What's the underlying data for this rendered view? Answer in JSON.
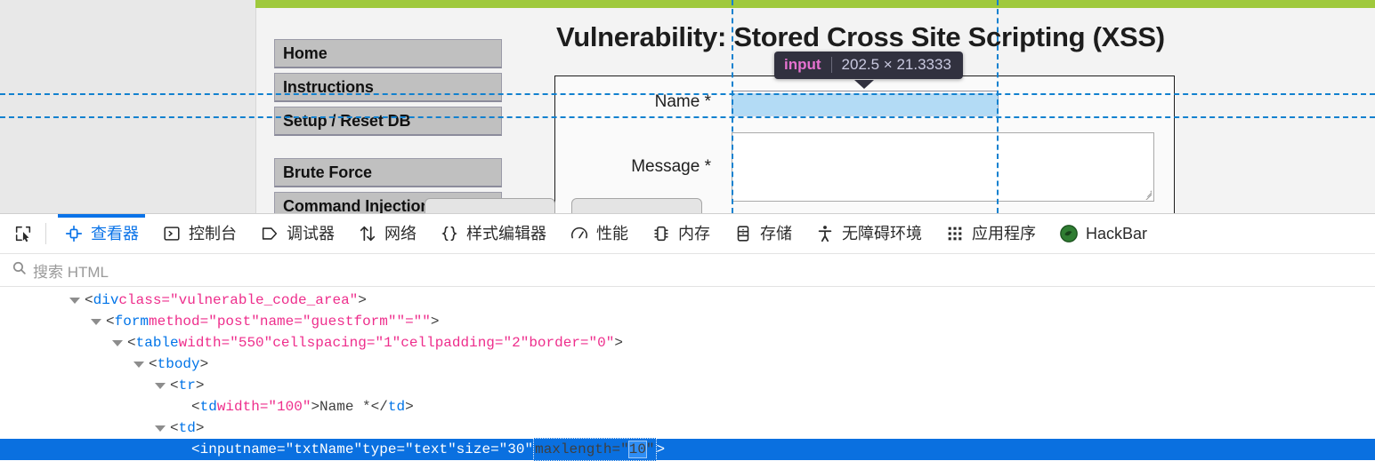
{
  "page": {
    "title": "Vulnerability: Stored Cross Site Scripting (XSS)",
    "accent_green": "#9fc93c",
    "menu": [
      {
        "label": "Home"
      },
      {
        "label": "Instructions"
      },
      {
        "label": "Setup / Reset DB"
      },
      {
        "label": "Brute Force"
      },
      {
        "label": "Command Injection"
      }
    ],
    "form": {
      "name_label": "Name *",
      "name_value": "",
      "message_label": "Message *",
      "message_value": ""
    }
  },
  "highlight_tooltip": {
    "tag": "input",
    "dimensions": "202.5 × 21.3333"
  },
  "devtools": {
    "picker_icon": "element-picker-icon",
    "tabs": [
      {
        "label": "查看器",
        "icon": "inspector-icon",
        "active": true
      },
      {
        "label": "控制台",
        "icon": "console-icon",
        "active": false
      },
      {
        "label": "调试器",
        "icon": "debugger-icon",
        "active": false
      },
      {
        "label": "网络",
        "icon": "network-icon",
        "active": false
      },
      {
        "label": "样式编辑器",
        "icon": "style-editor-icon",
        "active": false
      },
      {
        "label": "性能",
        "icon": "performance-icon",
        "active": false
      },
      {
        "label": "内存",
        "icon": "memory-icon",
        "active": false
      },
      {
        "label": "存储",
        "icon": "storage-icon",
        "active": false
      },
      {
        "label": "无障碍环境",
        "icon": "accessibility-icon",
        "active": false
      },
      {
        "label": "应用程序",
        "icon": "application-icon",
        "active": false
      },
      {
        "label": "HackBar",
        "icon": "hackbar-icon",
        "active": false
      }
    ],
    "search": {
      "placeholder": "搜索 HTML",
      "value": "",
      "icon": "search-icon"
    },
    "markup": {
      "lines": [
        {
          "id": "l1",
          "indent": 78,
          "twisty": true,
          "selected": false,
          "parts": [
            {
              "t": "punct",
              "v": "<"
            },
            {
              "t": "tag",
              "v": "div"
            },
            {
              "t": "punct",
              "v": " "
            },
            {
              "t": "attr",
              "v": "class=\"vulnerable_code_area\""
            },
            {
              "t": "punct",
              "v": ">"
            }
          ]
        },
        {
          "id": "l2",
          "indent": 102,
          "twisty": true,
          "selected": false,
          "parts": [
            {
              "t": "punct",
              "v": "<"
            },
            {
              "t": "tag",
              "v": "form"
            },
            {
              "t": "punct",
              "v": " "
            },
            {
              "t": "attr",
              "v": "method=\"post\""
            },
            {
              "t": "punct",
              "v": " "
            },
            {
              "t": "attr",
              "v": "name=\"guestform\""
            },
            {
              "t": "punct",
              "v": " "
            },
            {
              "t": "attr",
              "v": "\"=\"\""
            },
            {
              "t": "punct",
              "v": ">"
            }
          ]
        },
        {
          "id": "l3",
          "indent": 126,
          "twisty": true,
          "selected": false,
          "parts": [
            {
              "t": "punct",
              "v": "<"
            },
            {
              "t": "tag",
              "v": "table"
            },
            {
              "t": "punct",
              "v": " "
            },
            {
              "t": "attr",
              "v": "width=\"550\""
            },
            {
              "t": "punct",
              "v": " "
            },
            {
              "t": "attr",
              "v": "cellspacing=\"1\""
            },
            {
              "t": "punct",
              "v": " "
            },
            {
              "t": "attr",
              "v": "cellpadding=\"2\""
            },
            {
              "t": "punct",
              "v": " "
            },
            {
              "t": "attr",
              "v": "border=\"0\""
            },
            {
              "t": "punct",
              "v": ">"
            }
          ]
        },
        {
          "id": "l4",
          "indent": 150,
          "twisty": true,
          "selected": false,
          "parts": [
            {
              "t": "punct",
              "v": "<"
            },
            {
              "t": "tag",
              "v": "tbody"
            },
            {
              "t": "punct",
              "v": ">"
            }
          ]
        },
        {
          "id": "l5",
          "indent": 174,
          "twisty": true,
          "selected": false,
          "parts": [
            {
              "t": "punct",
              "v": "<"
            },
            {
              "t": "tag",
              "v": "tr"
            },
            {
              "t": "punct",
              "v": ">"
            }
          ]
        },
        {
          "id": "l6",
          "indent": 198,
          "twisty": false,
          "selected": false,
          "parts": [
            {
              "t": "punct",
              "v": "<"
            },
            {
              "t": "tag",
              "v": "td"
            },
            {
              "t": "punct",
              "v": " "
            },
            {
              "t": "attr",
              "v": "width=\"100\""
            },
            {
              "t": "punct",
              "v": ">"
            },
            {
              "t": "txt",
              "v": "Name *"
            },
            {
              "t": "punct",
              "v": "</"
            },
            {
              "t": "tag",
              "v": "td"
            },
            {
              "t": "punct",
              "v": ">"
            }
          ]
        },
        {
          "id": "l7",
          "indent": 174,
          "twisty": true,
          "selected": false,
          "parts": [
            {
              "t": "punct",
              "v": "<"
            },
            {
              "t": "tag",
              "v": "td"
            },
            {
              "t": "punct",
              "v": ">"
            }
          ]
        },
        {
          "id": "l8",
          "indent": 198,
          "twisty": false,
          "selected": true,
          "editing_attr": {
            "name": "maxlength=\"",
            "value": "10",
            "tail": "\""
          },
          "parts": [
            {
              "t": "punct",
              "v": "<"
            },
            {
              "t": "tag",
              "v": "input"
            },
            {
              "t": "punct",
              "v": " "
            },
            {
              "t": "attr",
              "v": "name=\"txtName\""
            },
            {
              "t": "punct",
              "v": " "
            },
            {
              "t": "attr",
              "v": "type=\"text\""
            },
            {
              "t": "punct",
              "v": " "
            },
            {
              "t": "attr",
              "v": "size=\"30\""
            },
            {
              "t": "punct",
              "v": " "
            }
          ],
          "tail_parts": [
            {
              "t": "punct",
              "v": ">"
            }
          ]
        }
      ]
    }
  }
}
